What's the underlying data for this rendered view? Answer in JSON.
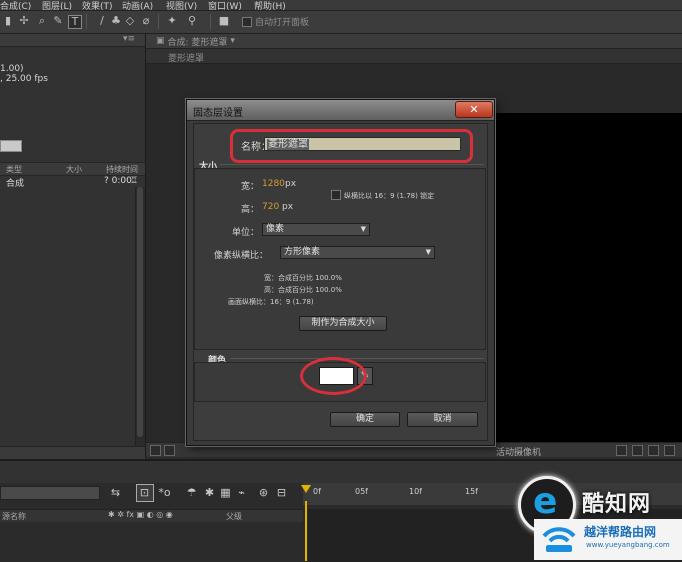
{
  "menu": {
    "items": [
      "合成(C)",
      "图层(L)",
      "效果(T)",
      "动画(A)",
      "视图(V)",
      "窗口(W)",
      "帮助(H)"
    ]
  },
  "toolbar": {
    "auto_open_label": "自动打开面板",
    "icons": [
      "selection-icon",
      "hand-icon",
      "zoom-icon",
      "rotate-icon",
      "text-tool-icon",
      "pen-icon",
      "brush-icon",
      "eraser-icon",
      "puppet-icon"
    ]
  },
  "project": {
    "info_line1": "1.00)",
    "info_line2": ", 25.00 fps",
    "columns": {
      "type": "类型",
      "size": "大小",
      "duration": "持续时间"
    },
    "row": {
      "type": "合成",
      "duration": "? 0:00"
    }
  },
  "composition": {
    "tab_label": "合成: 菱形遮罩",
    "sub_label": "菱形遮罩",
    "camera_label": "活动摄像机"
  },
  "timeline": {
    "ticks": [
      "0f",
      "05f",
      "10f",
      "15f"
    ],
    "source_col": "源名称",
    "parent_col": "父级"
  },
  "dialog": {
    "title": "固态层设置",
    "name_label": "名称：",
    "name_value": "菱形遮罩",
    "size_group": "大小",
    "width_label": "宽：",
    "width_value": "1280",
    "height_label": "高：",
    "height_value": "720",
    "px": "px",
    "aspect_lock_label": "纵横比以 16：9 (1.78) 锁定",
    "units_label": "单位：",
    "units_value": "像素",
    "pixel_aspect_label": "像素纵横比：",
    "pixel_aspect_value": "方形像素",
    "info_width": "宽：合成百分比 100.0%",
    "info_height": "高：合成百分比 100.0%",
    "info_frame_aspect": "画面纵横比：16：9 (1.78)",
    "make_comp_size_btn": "制作为合成大小",
    "color_group": "颜色",
    "color_value": "#ffffff",
    "ok_btn": "确定",
    "cancel_btn": "取消",
    "highlight_color": "#d8303b"
  },
  "watermark": {
    "brand_cn": "酷知网",
    "site_name": "越洋帮路由网",
    "site_url": "www.yueyangbang.com"
  }
}
